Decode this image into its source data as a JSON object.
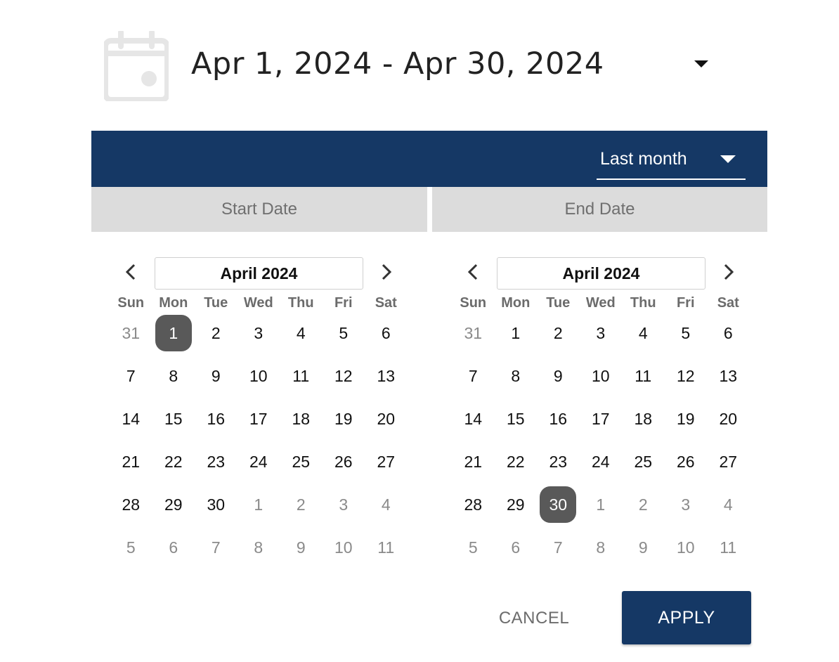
{
  "trigger": {
    "range_text": "Apr 1, 2024 - Apr 30, 2024",
    "icon": "calendar-icon",
    "caret_icon": "caret-down-icon"
  },
  "header": {
    "preset_label": "Last month",
    "preset_caret_icon": "caret-down-icon",
    "color": "#153865"
  },
  "tabs": {
    "start": "Start Date",
    "end": "End Date"
  },
  "weekdays": [
    "Sun",
    "Mon",
    "Tue",
    "Wed",
    "Thu",
    "Fri",
    "Sat"
  ],
  "calendars": [
    {
      "title": "April 2024",
      "weeks": [
        [
          {
            "d": "31",
            "m": true
          },
          {
            "d": "1",
            "s": true
          },
          {
            "d": "2"
          },
          {
            "d": "3"
          },
          {
            "d": "4"
          },
          {
            "d": "5"
          },
          {
            "d": "6"
          }
        ],
        [
          {
            "d": "7"
          },
          {
            "d": "8"
          },
          {
            "d": "9"
          },
          {
            "d": "10"
          },
          {
            "d": "11"
          },
          {
            "d": "12"
          },
          {
            "d": "13"
          }
        ],
        [
          {
            "d": "14"
          },
          {
            "d": "15"
          },
          {
            "d": "16"
          },
          {
            "d": "17"
          },
          {
            "d": "18"
          },
          {
            "d": "19"
          },
          {
            "d": "20"
          }
        ],
        [
          {
            "d": "21"
          },
          {
            "d": "22"
          },
          {
            "d": "23"
          },
          {
            "d": "24"
          },
          {
            "d": "25"
          },
          {
            "d": "26"
          },
          {
            "d": "27"
          }
        ],
        [
          {
            "d": "28"
          },
          {
            "d": "29"
          },
          {
            "d": "30"
          },
          {
            "d": "1",
            "m": true
          },
          {
            "d": "2",
            "m": true
          },
          {
            "d": "3",
            "m": true
          },
          {
            "d": "4",
            "m": true
          }
        ],
        [
          {
            "d": "5",
            "m": true
          },
          {
            "d": "6",
            "m": true
          },
          {
            "d": "7",
            "m": true
          },
          {
            "d": "8",
            "m": true
          },
          {
            "d": "9",
            "m": true
          },
          {
            "d": "10",
            "m": true
          },
          {
            "d": "11",
            "m": true
          }
        ]
      ]
    },
    {
      "title": "April 2024",
      "weeks": [
        [
          {
            "d": "31",
            "m": true
          },
          {
            "d": "1"
          },
          {
            "d": "2"
          },
          {
            "d": "3"
          },
          {
            "d": "4"
          },
          {
            "d": "5"
          },
          {
            "d": "6"
          }
        ],
        [
          {
            "d": "7"
          },
          {
            "d": "8"
          },
          {
            "d": "9"
          },
          {
            "d": "10"
          },
          {
            "d": "11"
          },
          {
            "d": "12"
          },
          {
            "d": "13"
          }
        ],
        [
          {
            "d": "14"
          },
          {
            "d": "15"
          },
          {
            "d": "16"
          },
          {
            "d": "17"
          },
          {
            "d": "18"
          },
          {
            "d": "19"
          },
          {
            "d": "20"
          }
        ],
        [
          {
            "d": "21"
          },
          {
            "d": "22"
          },
          {
            "d": "23"
          },
          {
            "d": "24"
          },
          {
            "d": "25"
          },
          {
            "d": "26"
          },
          {
            "d": "27"
          }
        ],
        [
          {
            "d": "28"
          },
          {
            "d": "29"
          },
          {
            "d": "30",
            "s": true
          },
          {
            "d": "1",
            "m": true
          },
          {
            "d": "2",
            "m": true
          },
          {
            "d": "3",
            "m": true
          },
          {
            "d": "4",
            "m": true
          }
        ],
        [
          {
            "d": "5",
            "m": true
          },
          {
            "d": "6",
            "m": true
          },
          {
            "d": "7",
            "m": true
          },
          {
            "d": "8",
            "m": true
          },
          {
            "d": "9",
            "m": true
          },
          {
            "d": "10",
            "m": true
          },
          {
            "d": "11",
            "m": true
          }
        ]
      ]
    }
  ],
  "nav": {
    "prev_icon": "chevron-left-icon",
    "next_icon": "chevron-right-icon"
  },
  "actions": {
    "cancel": "CANCEL",
    "apply": "APPLY"
  },
  "colors": {
    "primary": "#153865",
    "selected_day": "#595959",
    "tab_bg": "#dcdcdc"
  }
}
